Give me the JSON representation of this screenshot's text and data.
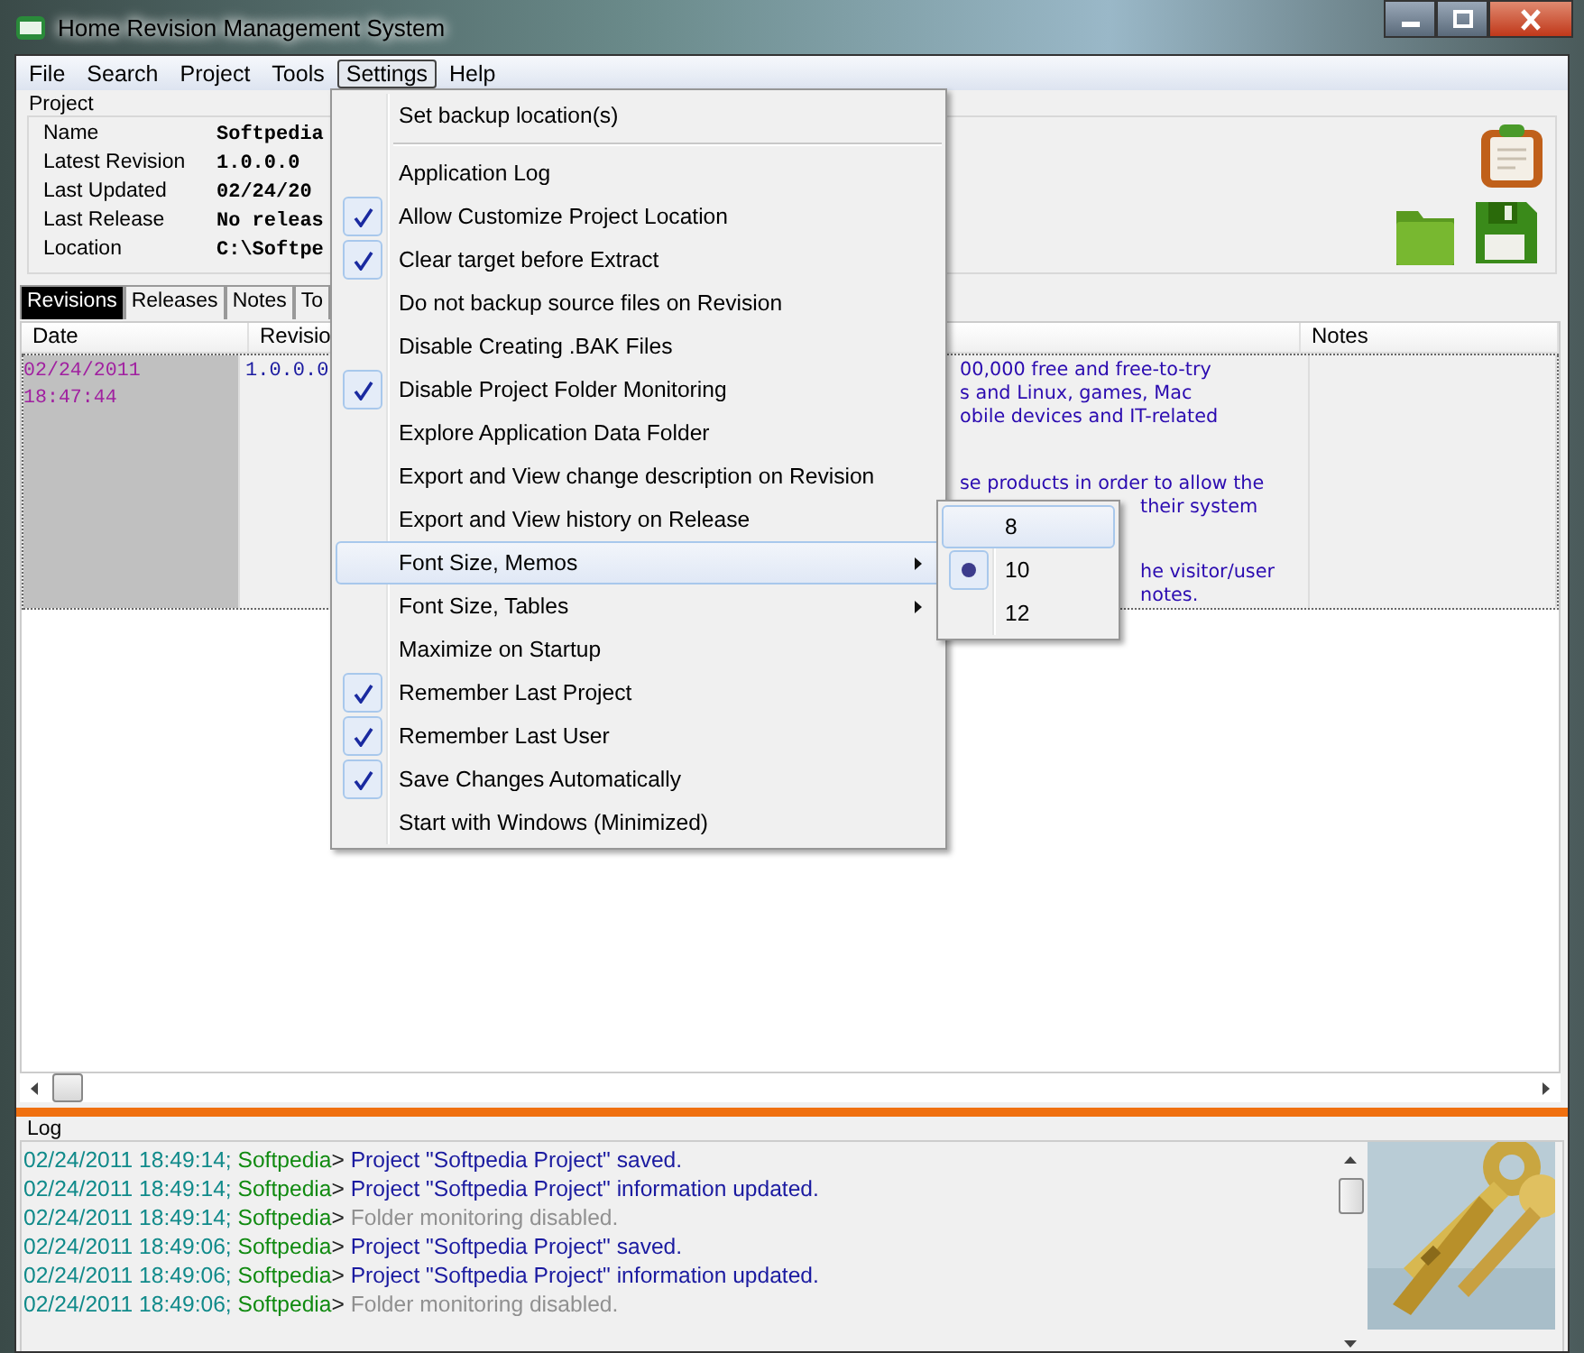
{
  "window": {
    "title": "Home Revision Management System"
  },
  "menu_bar": [
    {
      "label": "File",
      "selected": false
    },
    {
      "label": "Search",
      "selected": false
    },
    {
      "label": "Project",
      "selected": false
    },
    {
      "label": "Tools",
      "selected": false
    },
    {
      "label": "Settings",
      "selected": true
    },
    {
      "label": "Help",
      "selected": false
    }
  ],
  "project": {
    "title": "Project",
    "fields": [
      {
        "label": "Name",
        "value": "Softpedia"
      },
      {
        "label": "Latest Revision",
        "value": "1.0.0.0"
      },
      {
        "label": "Last Updated",
        "value": "02/24/20"
      },
      {
        "label": "Last Release",
        "value": "No releas"
      },
      {
        "label": "Location",
        "value": "C:\\Softpe"
      }
    ]
  },
  "tabs": [
    {
      "label": "Revisions",
      "selected": true
    },
    {
      "label": "Releases",
      "selected": false
    },
    {
      "label": "Notes",
      "selected": false
    },
    {
      "label": "To",
      "selected": false
    }
  ],
  "table": {
    "columns": [
      "Date",
      "Revisio",
      "Notes"
    ],
    "rows": [
      {
        "date": "02/24/2011 18:47:44",
        "revision": "1.0.0.0",
        "selected": true,
        "description": [
          {
            "kind": "text",
            "text": "00,000 free and free-to-try"
          },
          {
            "kind": "text",
            "text": "s and Linux, games, Mac"
          },
          {
            "kind": "text",
            "text": "obile devices and IT-related"
          },
          {
            "kind": "covered"
          },
          {
            "kind": "covered"
          },
          {
            "kind": "text",
            "text": "se products in order to allow the"
          },
          {
            "kind": "beside",
            "text": "their system"
          },
          {
            "kind": "covered"
          },
          {
            "kind": "covered"
          },
          {
            "kind": "beside",
            "text": "he visitor/user"
          },
          {
            "kind": "beside",
            "text": "notes."
          }
        ]
      }
    ]
  },
  "log": {
    "title": "Log",
    "entries": [
      {
        "time": "02/24/2011 18:49:14;",
        "user": "Softpedia",
        "sep": ">",
        "message": "Project \"Softpedia Project\" saved.",
        "kind": "info"
      },
      {
        "time": "02/24/2011 18:49:14;",
        "user": "Softpedia",
        "sep": ">",
        "message": "Project \"Softpedia Project\" information updated.",
        "kind": "info"
      },
      {
        "time": "02/24/2011 18:49:14;",
        "user": "Softpedia",
        "sep": ">",
        "message": "Folder monitoring disabled.",
        "kind": "notice"
      },
      {
        "time": "02/24/2011 18:49:06;",
        "user": "Softpedia",
        "sep": ">",
        "message": "Project \"Softpedia Project\" saved.",
        "kind": "info"
      },
      {
        "time": "02/24/2011 18:49:06;",
        "user": "Softpedia",
        "sep": ">",
        "message": "Project \"Softpedia Project\" information updated.",
        "kind": "info"
      },
      {
        "time": "02/24/2011 18:49:06;",
        "user": "Softpedia",
        "sep": ">",
        "message": "Folder monitoring disabled.",
        "kind": "notice"
      }
    ]
  },
  "settings_menu": {
    "items": [
      {
        "label": "Set backup location(s)",
        "checked": false,
        "selected": false,
        "submenu": false,
        "separator_after": true
      },
      {
        "label": "Application Log",
        "checked": false,
        "selected": false,
        "submenu": false
      },
      {
        "label": "Allow Customize Project Location",
        "checked": true,
        "selected": false,
        "submenu": false
      },
      {
        "label": "Clear target before Extract",
        "checked": true,
        "selected": false,
        "submenu": false
      },
      {
        "label": "Do not backup source files on Revision",
        "checked": false,
        "selected": false,
        "submenu": false
      },
      {
        "label": "Disable Creating .BAK Files",
        "checked": false,
        "selected": false,
        "submenu": false
      },
      {
        "label": "Disable Project Folder Monitoring",
        "checked": true,
        "selected": false,
        "submenu": false
      },
      {
        "label": "Explore Application Data Folder",
        "checked": false,
        "selected": false,
        "submenu": false
      },
      {
        "label": "Export and View change description on Revision",
        "checked": false,
        "selected": false,
        "submenu": false
      },
      {
        "label": "Export and View history on Release",
        "checked": false,
        "selected": false,
        "submenu": false
      },
      {
        "label": "Font Size, Memos",
        "checked": false,
        "selected": true,
        "submenu": true
      },
      {
        "label": "Font Size, Tables",
        "checked": false,
        "selected": false,
        "submenu": true
      },
      {
        "label": "Maximize on Startup",
        "checked": false,
        "selected": false,
        "submenu": false
      },
      {
        "label": "Remember Last Project",
        "checked": true,
        "selected": false,
        "submenu": false
      },
      {
        "label": "Remember Last User",
        "checked": true,
        "selected": false,
        "submenu": false
      },
      {
        "label": "Save Changes Automatically",
        "checked": true,
        "selected": false,
        "submenu": false
      },
      {
        "label": "Start with Windows (Minimized)",
        "checked": false,
        "selected": false,
        "submenu": false
      }
    ]
  },
  "font_size_submenu": {
    "items": [
      {
        "label": "8",
        "checked": false,
        "selected": true
      },
      {
        "label": "10",
        "checked": true,
        "selected": false
      },
      {
        "label": "12",
        "checked": false,
        "selected": false
      }
    ]
  }
}
